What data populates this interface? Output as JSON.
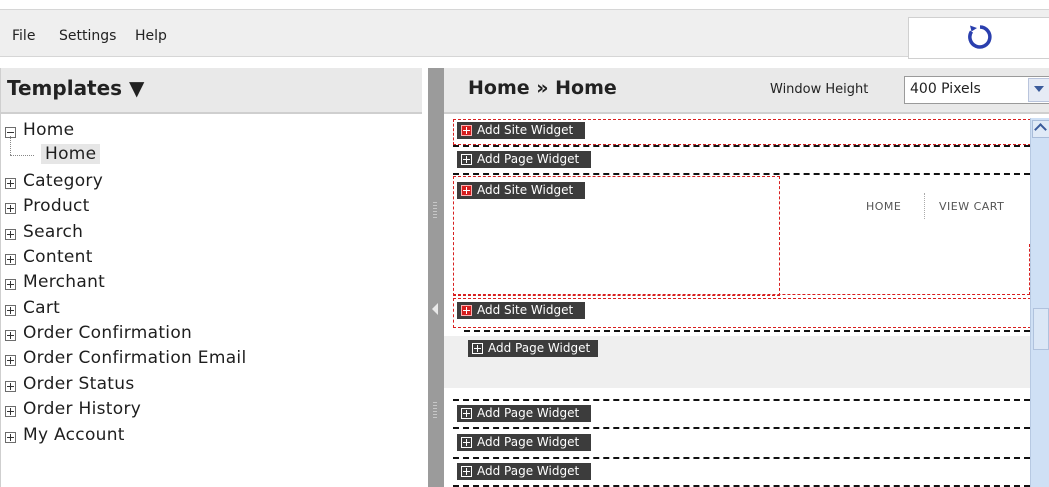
{
  "menu": {
    "file": "File",
    "settings": "Settings",
    "help": "Help"
  },
  "left": {
    "title": "Templates ▼",
    "tree": [
      {
        "label": "Home",
        "expanded": true
      },
      {
        "label": "Home",
        "child": true
      },
      {
        "label": "Category"
      },
      {
        "label": "Product"
      },
      {
        "label": "Search"
      },
      {
        "label": "Content"
      },
      {
        "label": "Merchant"
      },
      {
        "label": "Cart"
      },
      {
        "label": "Order Confirmation"
      },
      {
        "label": "Order Confirmation Email"
      },
      {
        "label": "Order Status"
      },
      {
        "label": "Order History"
      },
      {
        "label": "My Account"
      }
    ]
  },
  "right": {
    "breadcrumb": "Home » Home",
    "window_height_label": "Window Height",
    "window_height_value": "400 Pixels",
    "widgets": {
      "site1": "Add Site Widget",
      "page1": "Add Page Widget",
      "site2": "Add Site Widget",
      "site3": "Add Site Widget",
      "page2": "Add Page Widget",
      "page3": "Add Page Widget",
      "page4": "Add Page Widget",
      "page5": "Add Page Widget"
    },
    "nav_home": "HOME",
    "nav_cart": "VIEW CART"
  },
  "colors": {
    "site_zone": "#d82020",
    "widget_bg": "#3c3c3c",
    "spinner": "#2a3fae"
  }
}
